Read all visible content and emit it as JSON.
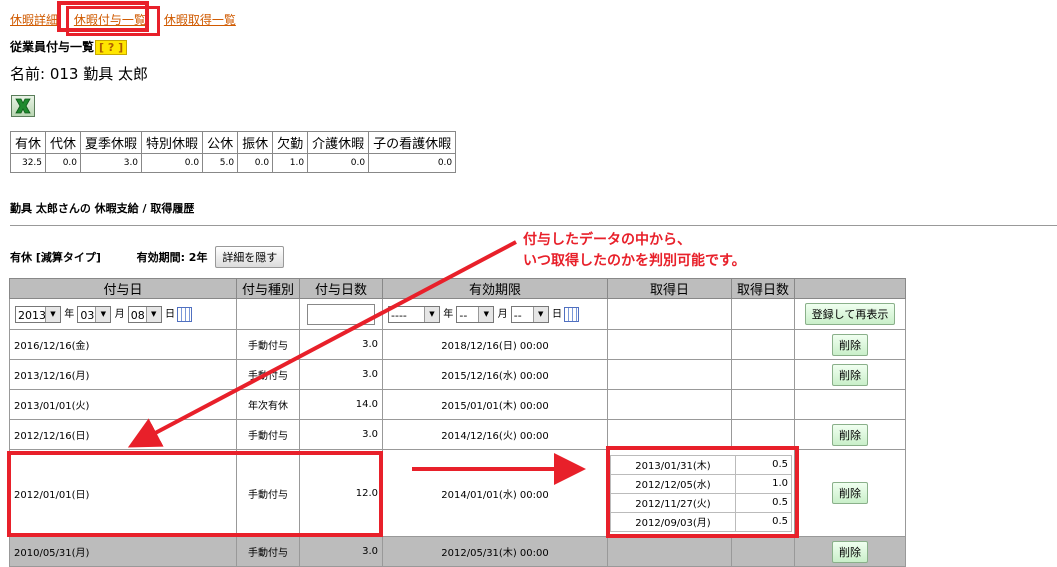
{
  "nav": {
    "tab_detail": "休暇詳細",
    "tab_grant_list": "休暇付与一覧",
    "tab_acquire_list": "休暇取得一覧"
  },
  "section_title": "従業員付与一覧",
  "help_label": "[ ? ]",
  "employee_name": "名前: 013 勤具 太郎",
  "excel_icon": "excel-export-icon",
  "summary": {
    "headers": [
      "有休",
      "代休",
      "夏季休暇",
      "特別休暇",
      "公休",
      "振休",
      "欠勤",
      "介護休暇",
      "子の看護休暇"
    ],
    "values": [
      "32.5",
      "0.0",
      "3.0",
      "0.0",
      "5.0",
      "0.0",
      "1.0",
      "0.0",
      "0.0"
    ]
  },
  "history_title": "勤具 太郎さんの 休暇支給 / 取得履歴",
  "leave_type": {
    "label": "有休 [減算タイプ]",
    "validity": "有効期間: 2年",
    "toggle_button": "詳細を隠す"
  },
  "grid": {
    "headers": [
      "付与日",
      "付与種別",
      "付与日数",
      "有効期限",
      "取得日",
      "取得日数",
      ""
    ],
    "filter": {
      "year": "2013",
      "year_unit": "年",
      "month": "03",
      "month_unit": "月",
      "day": "08",
      "day_unit": "日",
      "exp_year": "----",
      "exp_month": "--",
      "exp_day": "--",
      "register_button": "登録して再表示"
    },
    "rows": [
      {
        "grant_date": "2016/12/16(金)",
        "kind": "手動付与",
        "days": "3.0",
        "expiry": "2018/12/16(日) 00:00",
        "delete": "削除"
      },
      {
        "grant_date": "2013/12/16(月)",
        "kind": "手動付与",
        "days": "3.0",
        "expiry": "2015/12/16(水) 00:00",
        "delete": "削除"
      },
      {
        "grant_date": "2013/01/01(火)",
        "kind": "年次有休",
        "days": "14.0",
        "expiry": "2015/01/01(木) 00:00",
        "delete": ""
      },
      {
        "grant_date": "2012/12/16(日)",
        "kind": "手動付与",
        "days": "3.0",
        "expiry": "2014/12/16(火) 00:00",
        "delete": "削除"
      },
      {
        "grant_date": "2012/01/01(日)",
        "kind": "手動付与",
        "days": "12.0",
        "expiry": "2014/01/01(水) 00:00",
        "delete": "削除",
        "acquisitions": [
          {
            "date": "2013/01/31(木)",
            "days": "0.5"
          },
          {
            "date": "2012/12/05(水)",
            "days": "1.0"
          },
          {
            "date": "2012/11/27(火)",
            "days": "0.5"
          },
          {
            "date": "2012/09/03(月)",
            "days": "0.5"
          }
        ]
      },
      {
        "grant_date": "2010/05/31(月)",
        "kind": "手動付与",
        "days": "3.0",
        "expiry": "2012/05/31(木) 00:00",
        "delete": "削除"
      }
    ]
  },
  "annotation": {
    "line1": "付与したデータの中から、",
    "line2": "いつ取得したのかを判別可能です。",
    "color": "#e8202a"
  }
}
